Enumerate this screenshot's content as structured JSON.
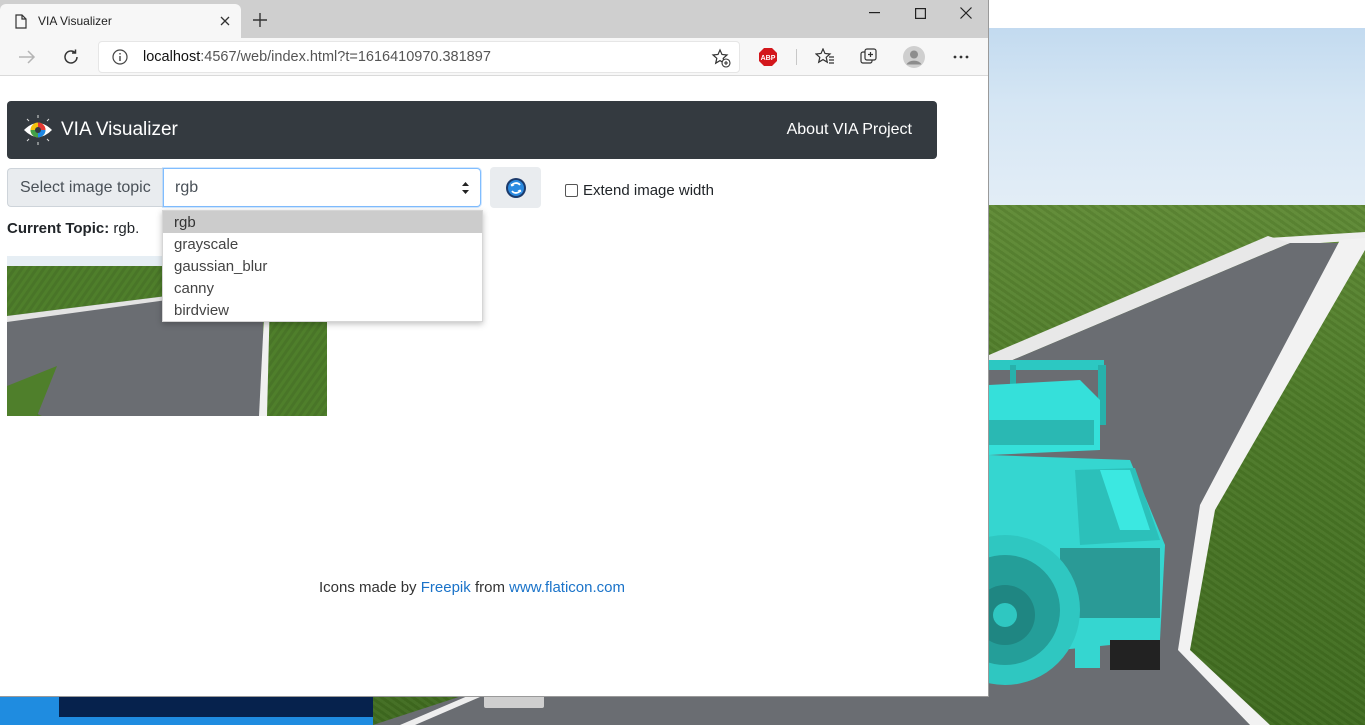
{
  "browser": {
    "tab_title": "VIA Visualizer",
    "url_host": "localhost",
    "url_rest": ":4567/web/index.html?t=1616410970.381897",
    "abp_label": "ABP"
  },
  "app": {
    "brand": "VIA Visualizer",
    "about_link": "About VIA Project",
    "select_label": "Select image topic",
    "selected_topic": "rgb",
    "topic_options": [
      "rgb",
      "grayscale",
      "gaussian_blur",
      "canny",
      "birdview"
    ],
    "extend_label": "Extend image width",
    "extend_checked": false,
    "current_topic_label": "Current Topic:",
    "current_topic_value": "rgb."
  },
  "footer": {
    "prefix": "Icons made by",
    "author": "Freepik",
    "middle": "from",
    "site": "www.flaticon.com"
  },
  "colors": {
    "navbar_bg": "#343a40",
    "link": "#1a73c9",
    "jeep": "#35e0da"
  }
}
